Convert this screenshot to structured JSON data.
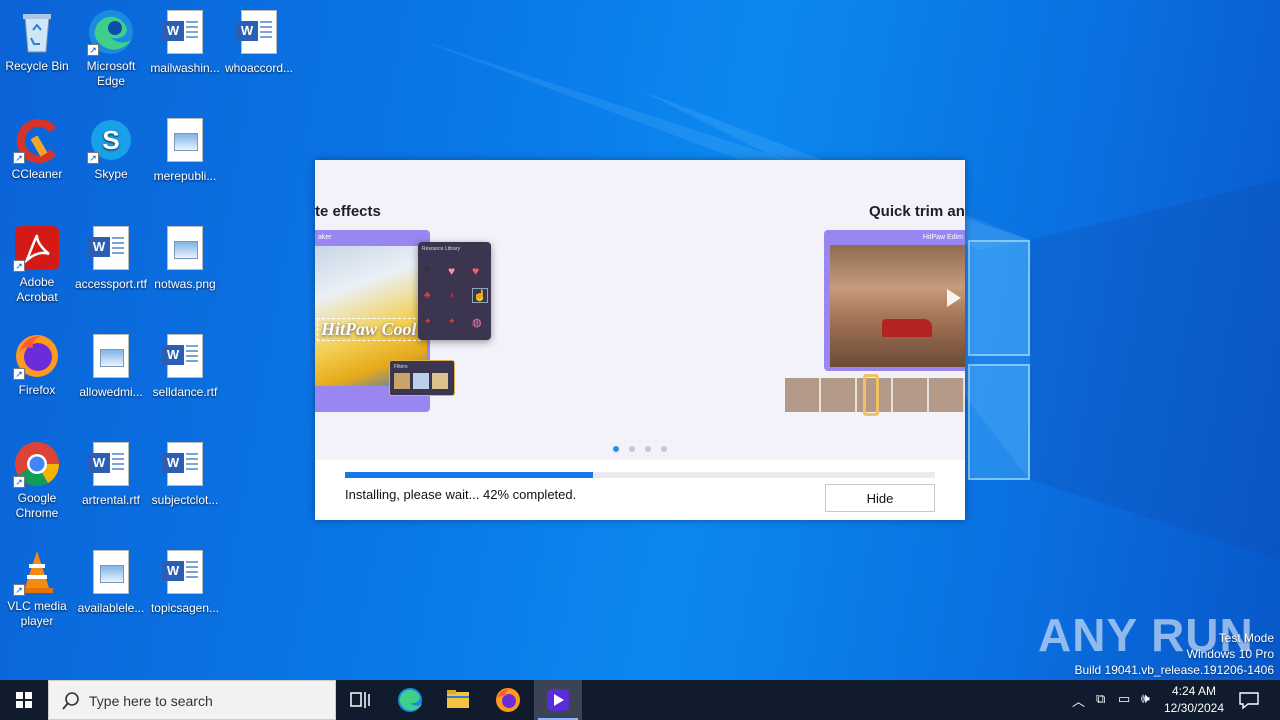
{
  "desktop": {
    "icons": [
      {
        "label": "Recycle Bin"
      },
      {
        "label": "Microsoft Edge"
      },
      {
        "label": "mailwashin..."
      },
      {
        "label": "whoaccord..."
      },
      {
        "label": "CCleaner"
      },
      {
        "label": "Skype"
      },
      {
        "label": "merepubli..."
      },
      {
        "label": "Adobe Acrobat"
      },
      {
        "label": "accessport.rtf"
      },
      {
        "label": "notwas.png"
      },
      {
        "label": "Firefox"
      },
      {
        "label": "allowedmi..."
      },
      {
        "label": "selldance.rtf"
      },
      {
        "label": "Google Chrome"
      },
      {
        "label": "artrental.rtf"
      },
      {
        "label": "subjectclot..."
      },
      {
        "label": "VLC media player"
      },
      {
        "label": "availablele..."
      },
      {
        "label": "topicsagen..."
      }
    ]
  },
  "installer": {
    "slide_left_title": "te effects",
    "slide_right_title": "Quick trim an",
    "left_mock_header": "aker",
    "left_mock_overlay": "HitPaw Cool",
    "left_panel_title": "Resource Library",
    "left_filter_title": "Filters",
    "right_mock_header": "HitPaw Edim",
    "progress_percent": 42,
    "status_text": "Installing, please wait... 42% completed.",
    "hide_label": "Hide",
    "carousel_dots": 4,
    "carousel_active": 0
  },
  "taskbar": {
    "search_placeholder": "Type here to search",
    "time": "4:24 AM",
    "date": "12/30/2024"
  },
  "watermark": {
    "brand": "ANY RUN",
    "line1": "Test Mode",
    "line2": "Windows 10 Pro",
    "line3": "Build 19041.vb_release.191206-1406"
  },
  "colors": {
    "accent": "#1677e6",
    "taskbar": "#101b2d"
  }
}
